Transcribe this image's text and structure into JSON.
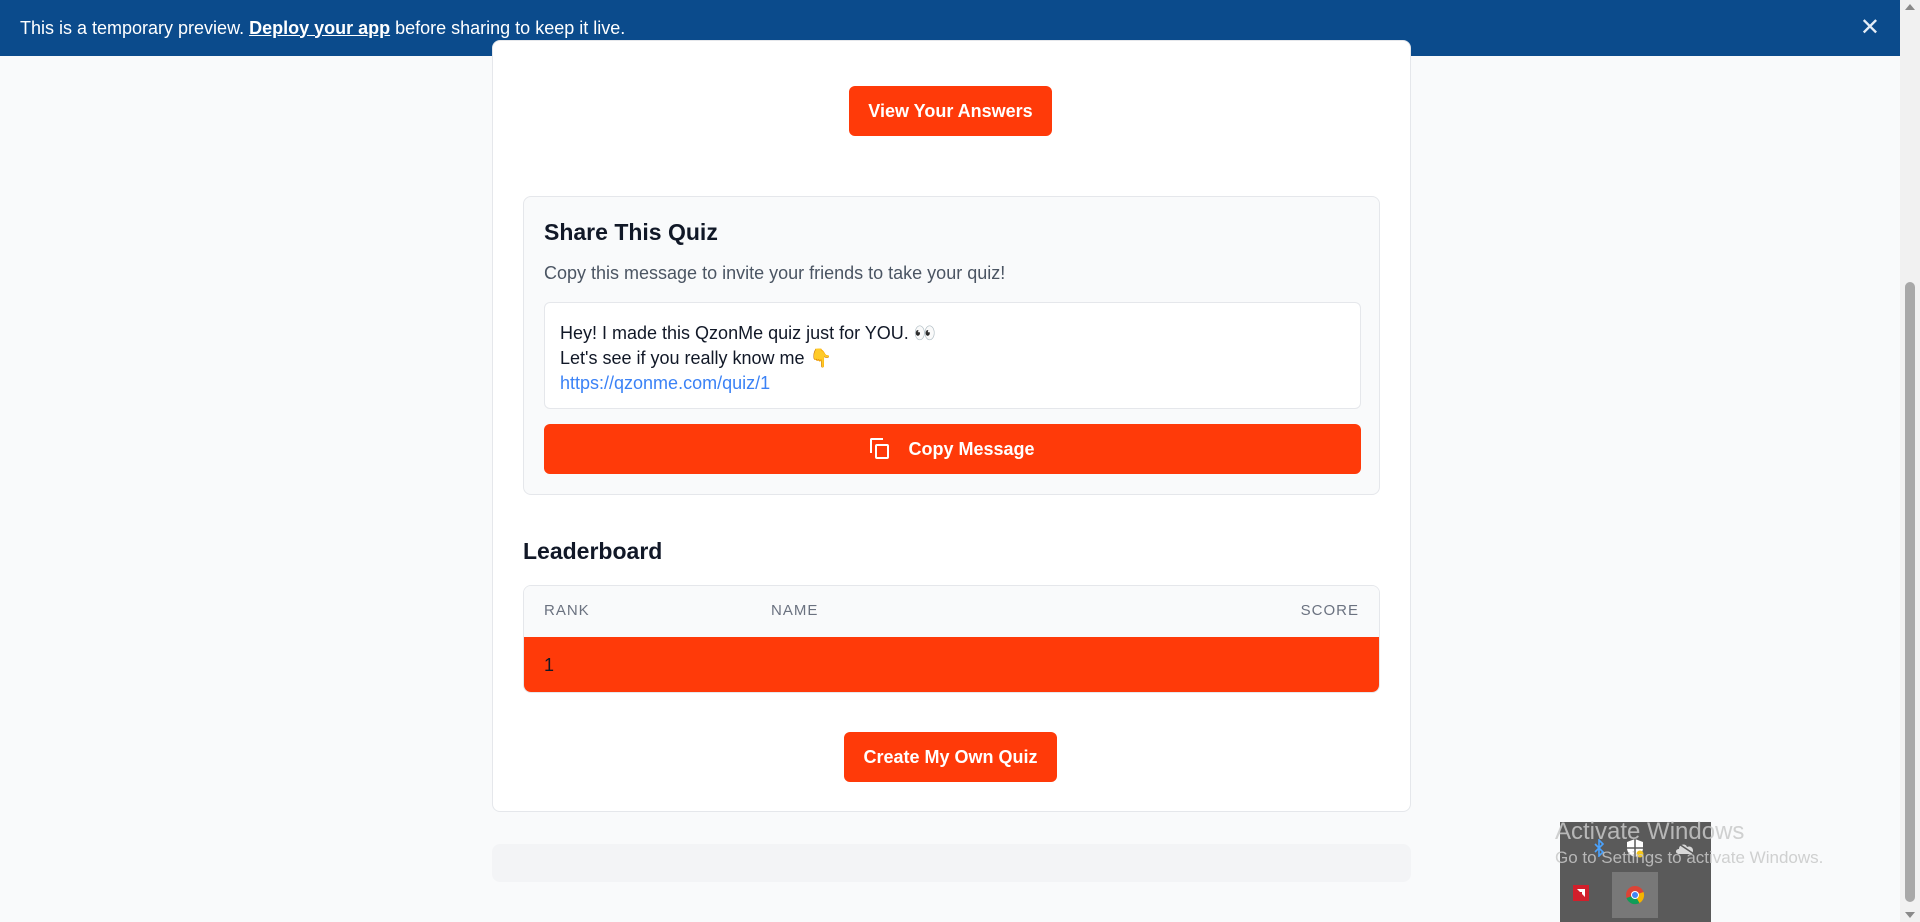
{
  "banner": {
    "text_before": "This is a temporary preview.",
    "link": "Deploy your app",
    "text_after": "before sharing to keep it live.",
    "close": "✕",
    "bg_color": "#0b4b8c"
  },
  "actions": {
    "view_answers": "View Your Answers",
    "create_quiz": "Create My Own Quiz",
    "accent_color": "#ff3a09"
  },
  "share": {
    "title": "Share This Quiz",
    "description": "Copy this message to invite your friends to take your quiz!",
    "message_line1": "Hey! I made this QzonMe quiz just for YOU. 👀",
    "message_line2": "Let's see if you really know me 👇",
    "message_link": "https://qzonme.com/quiz/1",
    "copy_button": "Copy Message",
    "copy_icon": "copy-icon"
  },
  "leaderboard": {
    "title": "Leaderboard",
    "columns": {
      "rank": "RANK",
      "name": "NAME",
      "score": "SCORE"
    },
    "rows": [
      {
        "rank": "1",
        "name": "",
        "score": ""
      }
    ]
  },
  "tray": {
    "icons": [
      "bluetooth-icon",
      "security-icon",
      "onedrive-icon",
      "amd-icon",
      "chrome-icon"
    ]
  },
  "watermark": {
    "line1": "Activate Windows",
    "line2": "Go to Settings to activate Windows."
  }
}
